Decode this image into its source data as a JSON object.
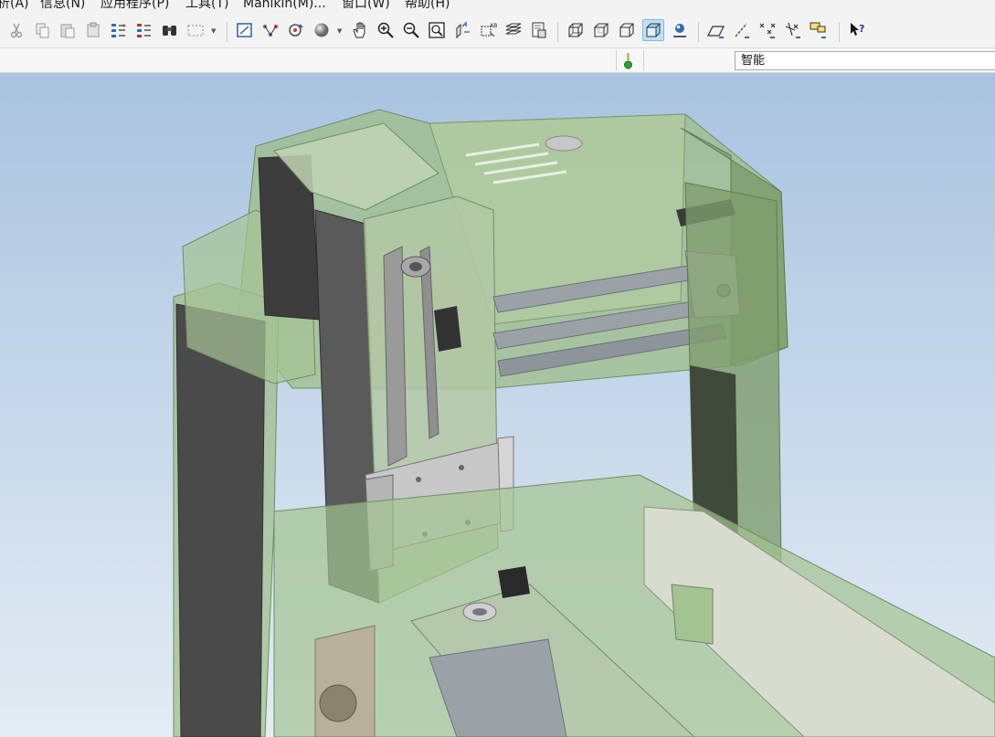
{
  "menubar": {
    "items": [
      "析(A)",
      "信息(N)",
      "应用程序(P)",
      "工具(T)",
      "Manikin(M)...",
      "窗口(W)",
      "帮助(H)"
    ]
  },
  "toolbar": {
    "icons": [
      "cut-icon",
      "copy-icon",
      "paste-icon",
      "paste-special-icon",
      "regenerate-icon",
      "regenerate-manager-icon",
      "find-icon",
      "select-box-icon",
      "repaint-icon",
      "spin-center-icon",
      "orient-icon",
      "appearance-sphere-icon",
      "pan-icon",
      "zoom-in-icon",
      "zoom-out-icon",
      "refit-icon",
      "reorient-icon",
      "saved-views-icon",
      "layers-icon",
      "view-manager-icon",
      "wireframe-icon",
      "hidden-line-icon",
      "no-hidden-icon",
      "shading-icon",
      "shading-with-reflections-icon",
      "datum-planes-icon",
      "datum-axes-icon",
      "point-display-icon",
      "coordinate-system-icon",
      "annotation-display-icon",
      "context-help-icon"
    ]
  },
  "statusbar": {
    "filter_value": "智能",
    "indicator_color": "#2fa32f"
  },
  "viewport": {
    "background_top": "#a9c3e0",
    "background_bottom": "#e4ecf4",
    "model_color": "#9dbd88"
  }
}
